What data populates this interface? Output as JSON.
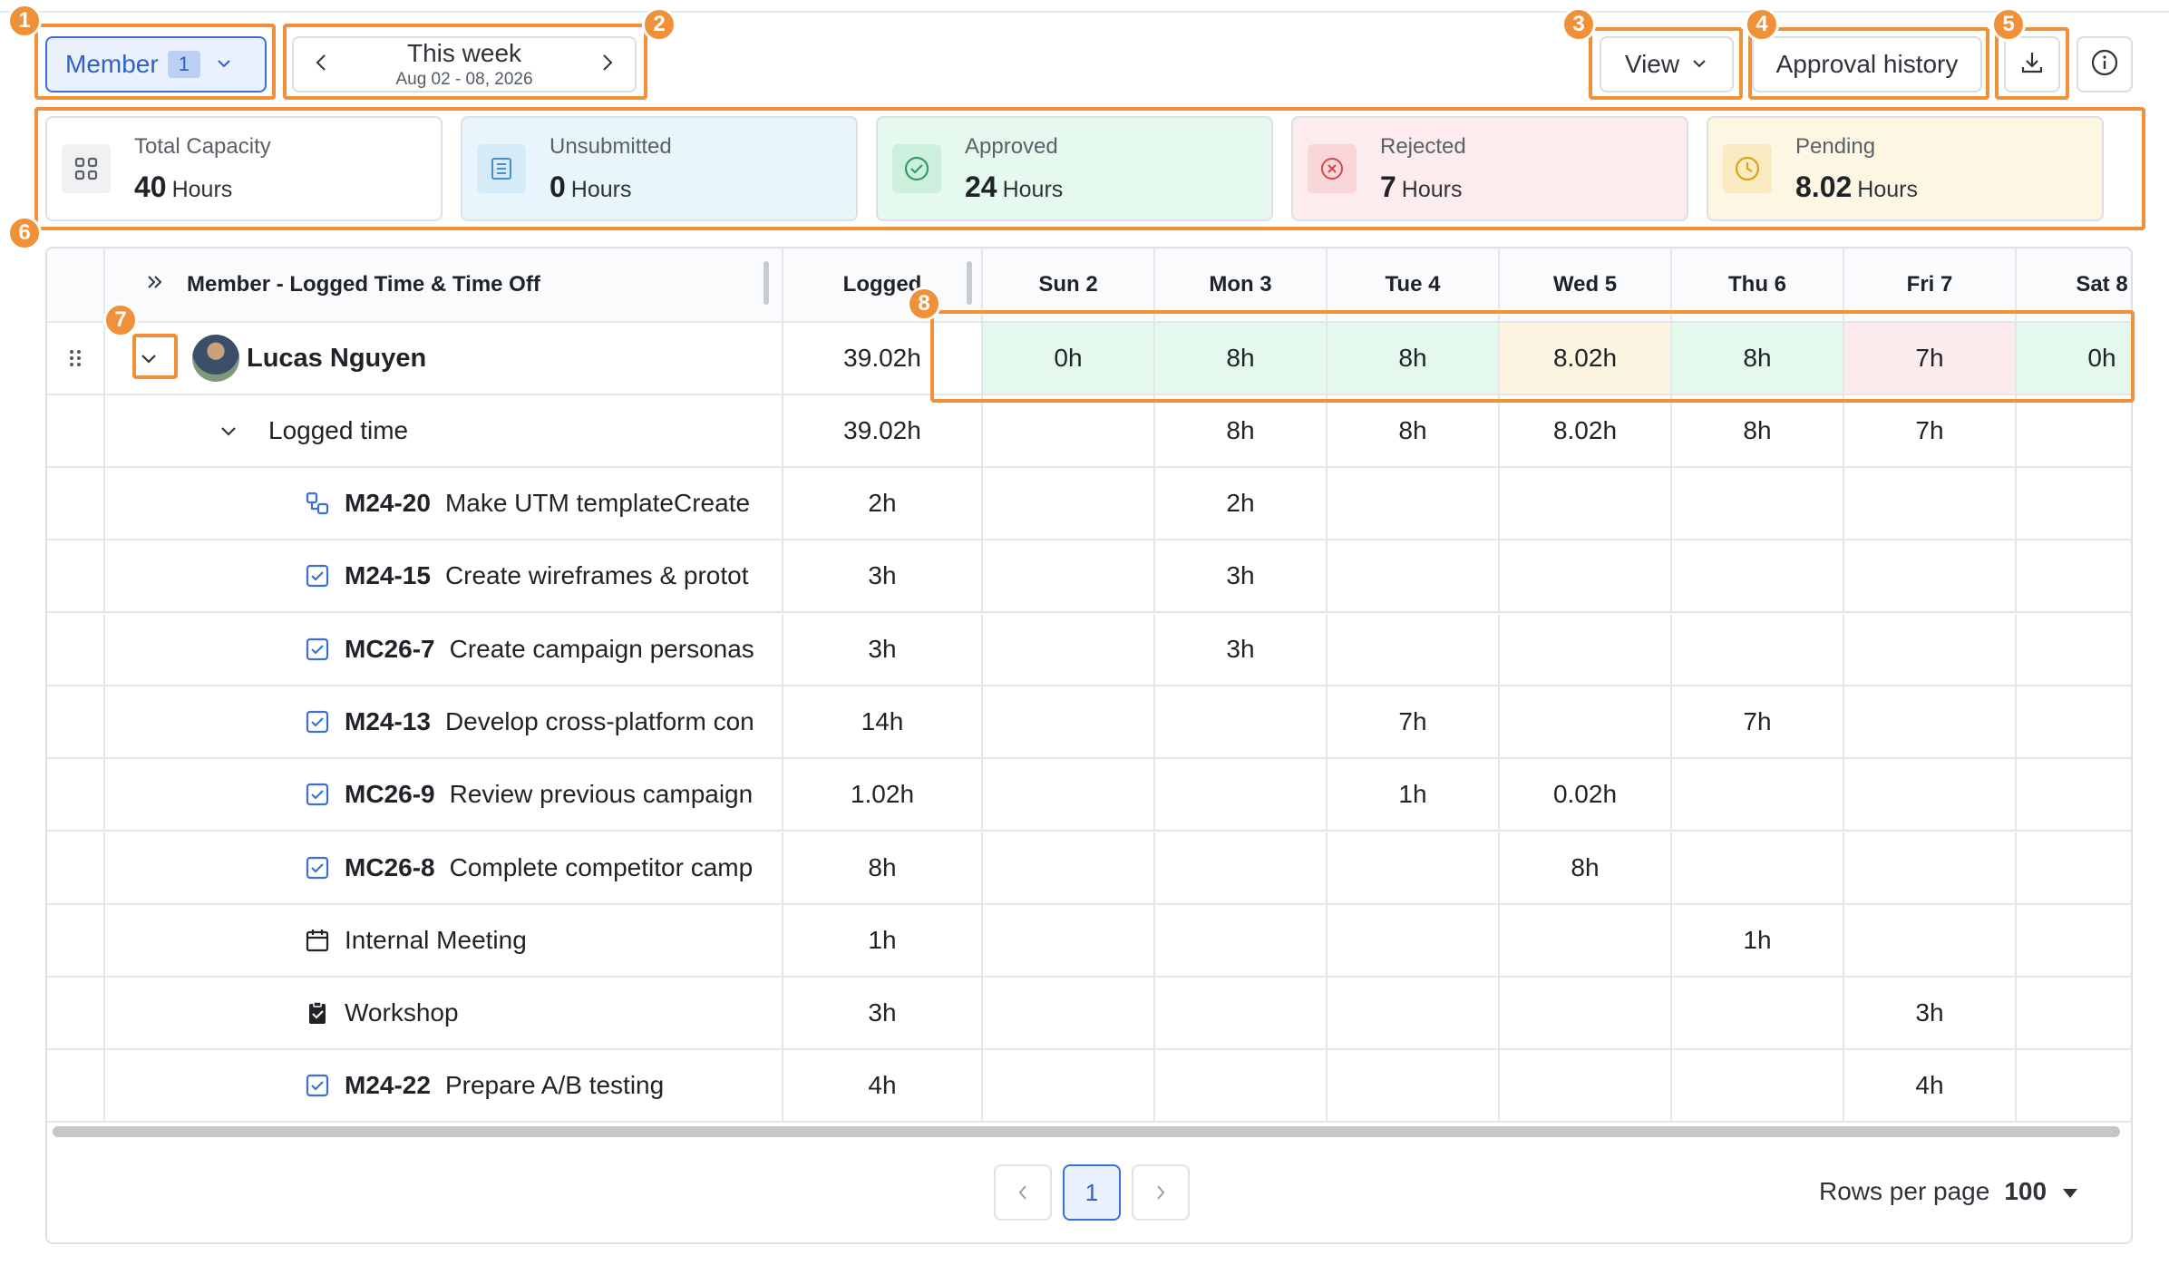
{
  "toolbar": {
    "member_label": "Member",
    "member_count": "1",
    "week_title": "This week",
    "week_range": "Aug 02 - 08, 2026",
    "view_label": "View",
    "approval_history_label": "Approval history"
  },
  "summary": [
    {
      "label": "Total Capacity",
      "value": "40",
      "unit": "Hours",
      "bg": "#ffffff",
      "icon_bg": "#f0f1f3",
      "icon": "grid-icon"
    },
    {
      "label": "Unsubmitted",
      "value": "0",
      "unit": "Hours",
      "bg": "#e9f5fc",
      "icon_bg": "#d6ebf8",
      "icon": "list-icon"
    },
    {
      "label": "Approved",
      "value": "24",
      "unit": "Hours",
      "bg": "#e6f9ef",
      "icon_bg": "#ccf0dd",
      "icon": "check-circle-icon"
    },
    {
      "label": "Rejected",
      "value": "7",
      "unit": "Hours",
      "bg": "#fdeced",
      "icon_bg": "#f9d6d8",
      "icon": "x-circle-icon"
    },
    {
      "label": "Pending",
      "value": "8.02",
      "unit": "Hours",
      "bg": "#fdf6e3",
      "icon_bg": "#f9eac2",
      "icon": "clock-icon"
    }
  ],
  "table": {
    "col_member": "Member - Logged Time & Time Off",
    "col_logged": "Logged",
    "days": [
      "Sun 2",
      "Mon 3",
      "Tue 4",
      "Wed 5",
      "Thu 6",
      "Fri 7",
      "Sat 8"
    ],
    "member": {
      "name": "Lucas Nguyen",
      "logged": "39.02h",
      "days": [
        "0h",
        "8h",
        "8h",
        "8.02h",
        "8h",
        "7h",
        "0h"
      ],
      "day_colors": [
        "#e4f8ee",
        "#e4f8ee",
        "#e4f8ee",
        "#fdf5e1",
        "#e4f8ee",
        "#fcebec",
        "#e4f8ee"
      ]
    },
    "logged_group": {
      "label": "Logged time",
      "logged": "39.02h",
      "days": [
        "",
        "8h",
        "8h",
        "8.02h",
        "8h",
        "7h",
        ""
      ]
    },
    "rows": [
      {
        "icon": "subtask-icon",
        "key": "M24-20",
        "title": "Make UTM templateCreate",
        "logged": "2h",
        "days": [
          "",
          "2h",
          "",
          "",
          "",
          "",
          ""
        ]
      },
      {
        "icon": "checkbox-icon",
        "key": "M24-15",
        "title": "Create wireframes & protot",
        "logged": "3h",
        "days": [
          "",
          "3h",
          "",
          "",
          "",
          "",
          ""
        ]
      },
      {
        "icon": "checkbox-icon",
        "key": "MC26-7",
        "title": "Create campaign personas",
        "logged": "3h",
        "days": [
          "",
          "3h",
          "",
          "",
          "",
          "",
          ""
        ]
      },
      {
        "icon": "checkbox-icon",
        "key": "M24-13",
        "title": "Develop cross-platform con",
        "logged": "14h",
        "days": [
          "",
          "",
          "7h",
          "",
          "7h",
          "",
          ""
        ]
      },
      {
        "icon": "checkbox-icon",
        "key": "MC26-9",
        "title": "Review previous campaign",
        "logged": "1.02h",
        "days": [
          "",
          "",
          "1h",
          "0.02h",
          "",
          "",
          ""
        ]
      },
      {
        "icon": "checkbox-icon",
        "key": "MC26-8",
        "title": "Complete competitor camp",
        "logged": "8h",
        "days": [
          "",
          "",
          "",
          "8h",
          "",
          "",
          ""
        ]
      },
      {
        "icon": "calendar-icon",
        "key": "",
        "title": "Internal Meeting",
        "logged": "1h",
        "days": [
          "",
          "",
          "",
          "",
          "1h",
          "",
          ""
        ]
      },
      {
        "icon": "clipboard-icon",
        "key": "",
        "title": "Workshop",
        "logged": "3h",
        "days": [
          "",
          "",
          "",
          "",
          "",
          "3h",
          ""
        ]
      },
      {
        "icon": "checkbox-icon",
        "key": "M24-22",
        "title": "Prepare A/B testing",
        "logged": "4h",
        "days": [
          "",
          "",
          "",
          "",
          "",
          "4h",
          ""
        ]
      }
    ]
  },
  "pagination": {
    "current_page": "1",
    "rows_per_page_label": "Rows per page",
    "rows_per_page_value": "100"
  },
  "annotations": [
    "1",
    "2",
    "3",
    "4",
    "5",
    "6",
    "7",
    "8"
  ],
  "colors": {
    "accent": "#3b6fd8",
    "annotation": "#f0913a"
  }
}
